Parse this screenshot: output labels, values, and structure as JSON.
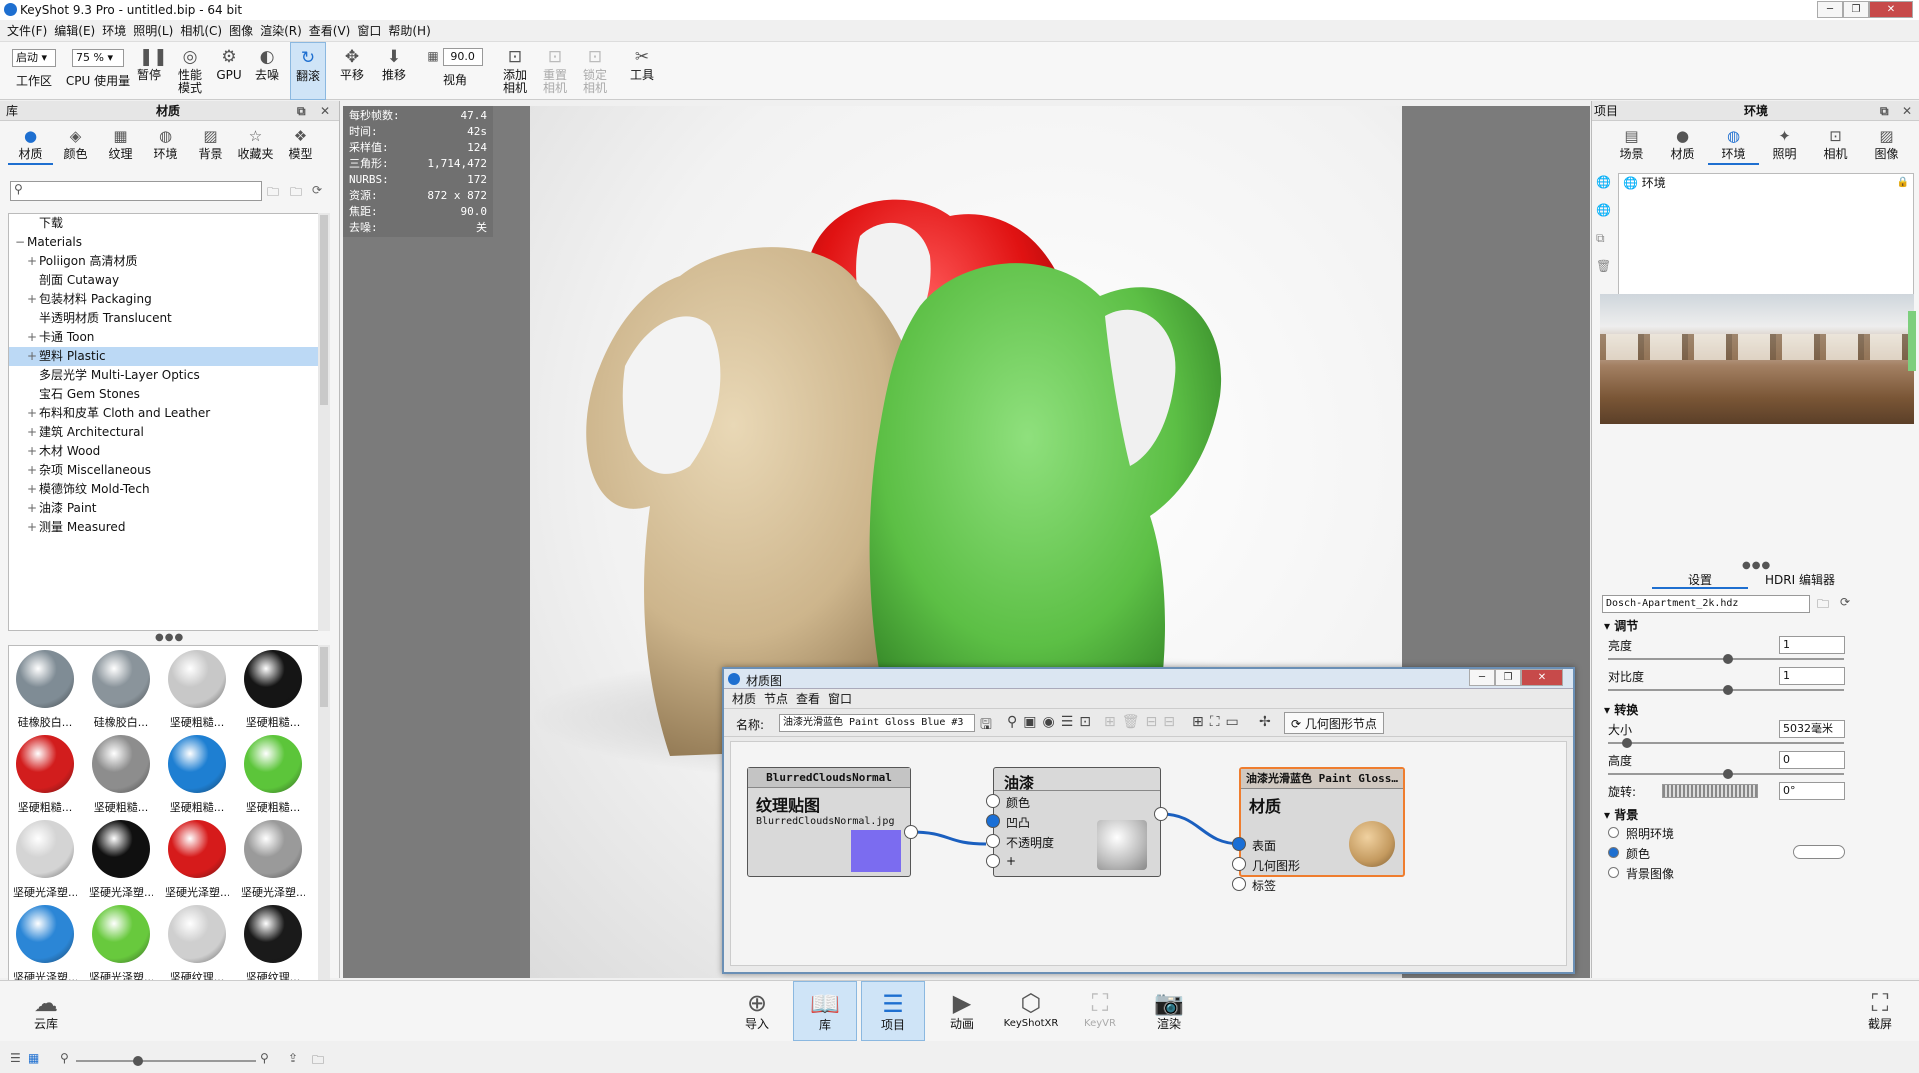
{
  "window": {
    "title": "KeyShot 9.3 Pro  - untitled.bip  - 64 bit"
  },
  "menu": [
    "文件(F)",
    "编辑(E)",
    "环境",
    "照明(L)",
    "相机(C)",
    "图像",
    "渲染(R)",
    "查看(V)",
    "窗口",
    "帮助(H)"
  ],
  "toolbar": {
    "workspace_value": "启动",
    "workspace_label": "工作区",
    "cpu_value": "75 %",
    "cpu_label": "CPU 使用量",
    "pause_label": "暂停",
    "perf_label": "性能\n模式",
    "gpu_label": "GPU",
    "denoise_label": "去噪",
    "tumble_label": "翻滚",
    "pan_label": "平移",
    "dolly_label": "推移",
    "fov_value": "90.0",
    "fov_label": "视角",
    "add_cam_label": "添加\n相机",
    "reset_cam_label": "重置\n相机",
    "lock_cam_label": "锁定\n相机",
    "tools_label": "工具"
  },
  "library": {
    "panel_label": "库",
    "title": "材质",
    "tabs": [
      "材质",
      "颜色",
      "纹理",
      "环境",
      "背景",
      "收藏夹",
      "模型"
    ],
    "tree": [
      {
        "label": "下载",
        "indent": 1
      },
      {
        "label": "Materials",
        "indent": 0
      },
      {
        "label": "Poliigon 高清材质",
        "indent": 1,
        "plus": true
      },
      {
        "label": "剖面 Cutaway",
        "indent": 1
      },
      {
        "label": "包装材料 Packaging",
        "indent": 1,
        "plus": true
      },
      {
        "label": "半透明材质 Translucent",
        "indent": 1
      },
      {
        "label": "卡通 Toon",
        "indent": 1,
        "plus": true
      },
      {
        "label": "塑料 Plastic",
        "indent": 1,
        "plus": true,
        "selected": true
      },
      {
        "label": "多层光学 Multi-Layer Optics",
        "indent": 1
      },
      {
        "label": "宝石 Gem Stones",
        "indent": 1
      },
      {
        "label": "布料和皮革 Cloth and Leather",
        "indent": 1,
        "plus": true
      },
      {
        "label": "建筑 Architectural",
        "indent": 1,
        "plus": true
      },
      {
        "label": "木材 Wood",
        "indent": 1,
        "plus": true
      },
      {
        "label": "杂项 Miscellaneous",
        "indent": 1,
        "plus": true
      },
      {
        "label": "模德饰纹 Mold-Tech",
        "indent": 1,
        "plus": true
      },
      {
        "label": "油漆 Paint",
        "indent": 1,
        "plus": true
      },
      {
        "label": "测量 Measured",
        "indent": 1,
        "plus": true
      }
    ],
    "thumbs": [
      {
        "label": "硅橡胶白...",
        "color": "#7f8c95"
      },
      {
        "label": "硅橡胶白...",
        "color": "#8a949b"
      },
      {
        "label": "坚硬粗糙...",
        "color": "#c8c8c8"
      },
      {
        "label": "坚硬粗糙...",
        "color": "#151515"
      },
      {
        "label": "坚硬粗糙...",
        "color": "#d21d1d"
      },
      {
        "label": "坚硬粗糙...",
        "color": "#8d8d8d"
      },
      {
        "label": "坚硬粗糙...",
        "color": "#1e7fd2"
      },
      {
        "label": "坚硬粗糙...",
        "color": "#5cc53a"
      },
      {
        "label": "坚硬光泽塑...",
        "color": "#d4d4d4"
      },
      {
        "label": "坚硬光泽塑...",
        "color": "#101010"
      },
      {
        "label": "坚硬光泽塑...",
        "color": "#d61b1b"
      },
      {
        "label": "坚硬光泽塑...",
        "color": "#9a9a9a"
      },
      {
        "label": "坚硬光泽塑...",
        "color": "#2b86d6"
      },
      {
        "label": "坚硬光泽塑...",
        "color": "#68c93d"
      },
      {
        "label": "坚硬纹理...",
        "color": "#cfcfcf"
      },
      {
        "label": "坚硬纹理...",
        "color": "#1a1a1a"
      },
      {
        "label": "",
        "color": "#d21d1d"
      },
      {
        "label": "",
        "color": "#8f8f8f"
      },
      {
        "label": "",
        "color": "#1e7fd2"
      },
      {
        "label": "",
        "color": "#5cc53a"
      }
    ]
  },
  "stats": [
    {
      "k": "每秒帧数:",
      "v": "47.4"
    },
    {
      "k": "时间:",
      "v": "42s"
    },
    {
      "k": "采样值:",
      "v": "124"
    },
    {
      "k": "三角形:",
      "v": "1,714,472"
    },
    {
      "k": "NURBS:",
      "v": "172"
    },
    {
      "k": "资源:",
      "v": "872 x 872"
    },
    {
      "k": "焦距:",
      "v": "90.0"
    },
    {
      "k": "去噪:",
      "v": "关"
    }
  ],
  "material_graph": {
    "title": "材质图",
    "menu": [
      "材质",
      "节点",
      "查看",
      "窗口"
    ],
    "name_label": "名称:",
    "name_value": "油漆光滑蓝色 Paint Gloss Blue #3",
    "geo_node_btn": "几何图形节点",
    "node_tex": {
      "header": "BlurredCloudsNormal",
      "title": "纹理贴图",
      "file": "BlurredCloudsNormal.jpg"
    },
    "node_paint": {
      "title": "油漆",
      "ports": [
        "颜色",
        "凹凸",
        "不透明度",
        "+"
      ]
    },
    "node_mat": {
      "header": "油漆光滑蓝色 Paint Gloss…",
      "title": "材质",
      "ports": [
        "表面",
        "几何图形",
        "标签"
      ]
    }
  },
  "project": {
    "panel_label": "项目",
    "title": "环境",
    "tabs": [
      "场景",
      "材质",
      "环境",
      "照明",
      "相机",
      "图像"
    ],
    "env_item": "环境",
    "subtabs": [
      "设置",
      "HDRI 编辑器"
    ],
    "hdr_file": "Dosch-Apartment_2k.hdz",
    "adjust": {
      "title": "调节",
      "brightness_label": "亮度",
      "brightness": "1",
      "contrast_label": "对比度",
      "contrast": "1"
    },
    "transform": {
      "title": "转换",
      "size_label": "大小",
      "size": "5032毫米",
      "height_label": "高度",
      "height": "0",
      "rotate_label": "旋转:",
      "rotate": "0°"
    },
    "background": {
      "title": "背景",
      "options": [
        "照明环境",
        "颜色",
        "背景图像"
      ],
      "selected": 1
    }
  },
  "bottom": {
    "cloud": "云库",
    "import": "导入",
    "library": "库",
    "project": "项目",
    "animation": "动画",
    "keyshotxr": "KeyShotXR",
    "keyvr": "KeyVR",
    "render": "渲染",
    "screenshot": "截屏"
  }
}
